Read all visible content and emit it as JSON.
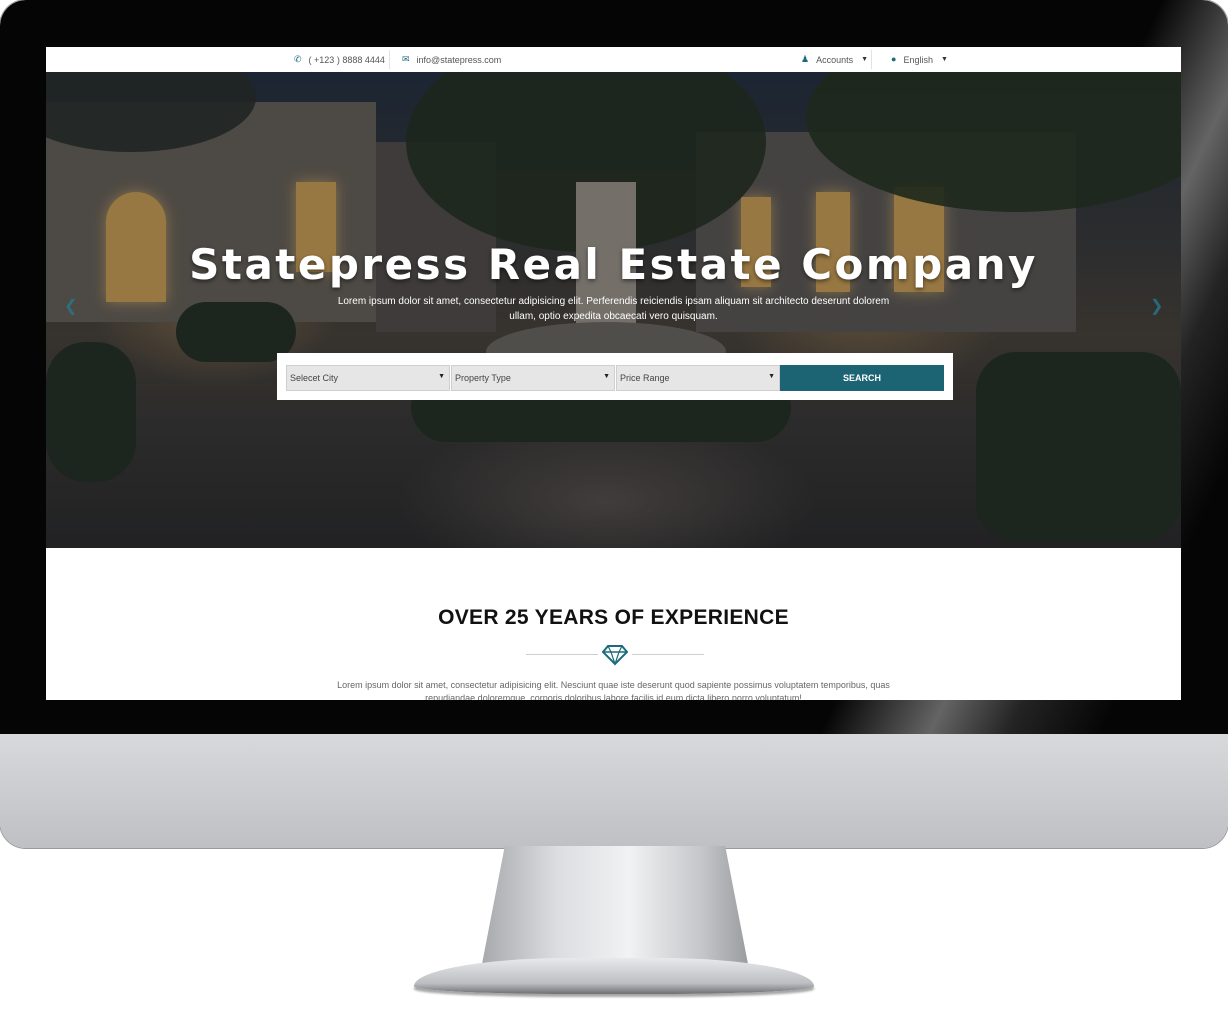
{
  "topbar": {
    "phone": "( +123 ) 8888 4444",
    "email": "info@statepress.com",
    "accounts": "Accounts",
    "language": "English"
  },
  "hero": {
    "title": "Statepress Real Estate Company",
    "subtitle": "Lorem ipsum dolor sit amet, consectetur adipisicing elit. Perferendis reiciendis ipsam aliquam sit architecto deserunt dolorem ullam, optio expedita obcaecati vero quisquam."
  },
  "search": {
    "city": "Selecet City",
    "property_type": "Property Type",
    "price_range": "Price Range",
    "button": "SEARCH"
  },
  "experience": {
    "title": "OVER 25 YEARS OF EXPERIENCE",
    "text": "Lorem ipsum dolor sit amet, consectetur adipisicing elit. Nesciunt quae iste deserunt quod sapiente possimus voluptatem temporibus, quas repudiandae doloremque, corporis doloribus labore facilis id eum dicta libero porro voluptatum!"
  },
  "colors": {
    "accent": "#1c6474",
    "icon": "#1c6b7b"
  },
  "icons": {
    "phone": "phone-icon",
    "email": "envelope-icon",
    "accounts": "user-icon",
    "language": "globe-icon",
    "divider": "diamond-icon"
  }
}
